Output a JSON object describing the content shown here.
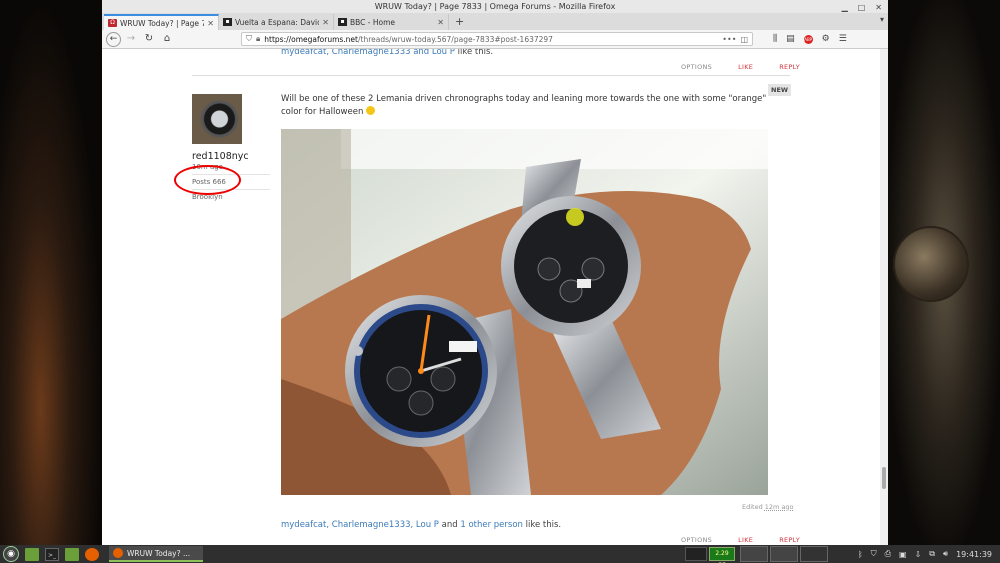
{
  "browser": {
    "window_title": "WRUW Today? | Page 7833 | Omega Forums - Mozilla Firefox",
    "tabs": [
      {
        "label": "WRUW Today? | Page 7833",
        "active": true
      },
      {
        "label": "Vuelta a Espana: David Ga",
        "active": false
      },
      {
        "label": "BBC - Home",
        "active": false
      }
    ],
    "url_domain": "https://omegaforums.net",
    "url_path": "/threads/wruw-today.567/page-7833#post-1637297"
  },
  "post_above": {
    "likers": "mydeafcat, Charlemagne1333 and Lou P",
    "likes_suffix": " like this."
  },
  "actions": {
    "options": "OPTIONS",
    "like": "LIKE",
    "reply": "REPLY"
  },
  "post": {
    "username": "red1108nyc",
    "joined": "10m ago",
    "posts": "Posts 666",
    "location": "Brooklyn",
    "badge": "NEW",
    "text": "Will be one of these 2 Lemania driven chronographs today and leaning more towards the one with some \"orange\" color for Halloween",
    "edited_prefix": "Edited ",
    "edited_time": "12m ago",
    "likers": "mydeafcat, Charlemagne1333, Lou P",
    "likers_and": " and ",
    "likers_other": "1 other person",
    "likes_suffix": " like this."
  },
  "taskbar": {
    "task_label": "WRUW Today? ...",
    "mem": "2.29 GB",
    "clock": "19:41:39"
  },
  "icons": [
    "back-icon",
    "forward-icon",
    "reload-icon",
    "home-icon",
    "shield-icon",
    "lock-icon",
    "more-icon",
    "pocket-icon",
    "library-icon",
    "sidebar-icon",
    "menu-icon"
  ],
  "colors": {
    "accent_red": "#d1323a",
    "link_blue": "#3b7ab8",
    "tab_highlight": "#3b8de0"
  }
}
